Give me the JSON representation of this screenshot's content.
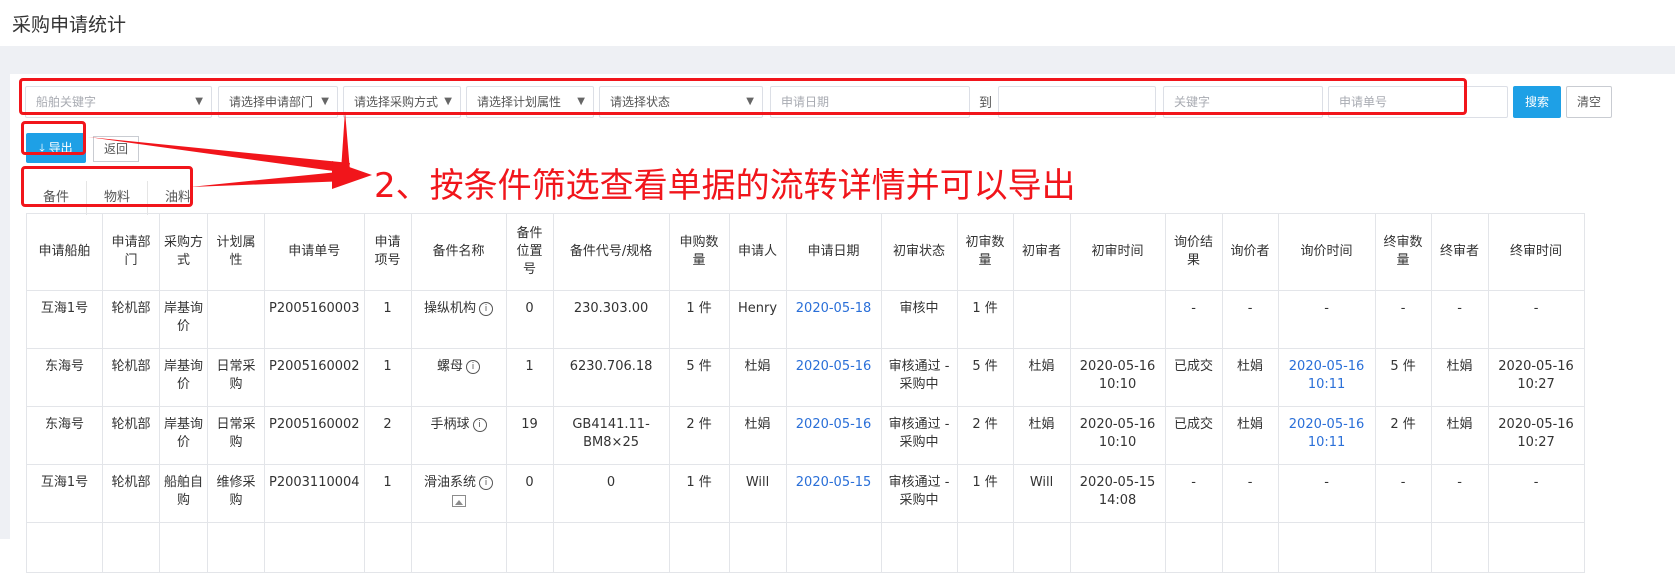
{
  "page": {
    "title": "采购申请统计"
  },
  "filters": {
    "ship": "船舶关键字",
    "dept": "请选择申请部门",
    "method": "请选择采购方式",
    "plan": "请选择计划属性",
    "status": "请选择状态",
    "date_start": "申请日期",
    "to": "到",
    "keyword": "关键字",
    "order_no": "申请单号",
    "search": "搜索",
    "clear": "清空"
  },
  "toolbar": {
    "export": "导出",
    "back": "返回"
  },
  "tabs": [
    "备件",
    "物料",
    "油料"
  ],
  "annotation": "2、按条件筛选查看单据的流转详情并可以导出",
  "table": {
    "columns": [
      "申请船舶",
      "申请部门",
      "采购方式",
      "计划属性",
      "申请单号",
      "申请项号",
      "备件名称",
      "备件位置号",
      "备件代号/规格",
      "申购数量",
      "申请人",
      "申请日期",
      "初审状态",
      "初审数量",
      "初审者",
      "初审时间",
      "询价结果",
      "询价者",
      "询价时间",
      "终审数量",
      "终审者",
      "终审时间"
    ],
    "rows": [
      [
        "互海1号",
        "轮机部",
        "岸基询价",
        "",
        "P2005160003",
        "1",
        "操纵机构",
        "0",
        "230.303.00",
        "1 件",
        "Henry",
        "2020-05-18",
        "审核中",
        "1 件",
        "",
        "",
        "-",
        "-",
        "-",
        "-",
        "-",
        "-"
      ],
      [
        "东海号",
        "轮机部",
        "岸基询价",
        "日常采购",
        "P2005160002",
        "1",
        "螺母",
        "1",
        "6230.706.18",
        "5 件",
        "杜娟",
        "2020-05-16",
        "审核通过 - 采购中",
        "5 件",
        "杜娟",
        "2020-05-16 10:10",
        "已成交",
        "杜娟",
        "2020-05-16 10:11",
        "5 件",
        "杜娟",
        "2020-05-16 10:27"
      ],
      [
        "东海号",
        "轮机部",
        "岸基询价",
        "日常采购",
        "P2005160002",
        "2",
        "手柄球",
        "19",
        "GB4141.11-BM8×25",
        "2 件",
        "杜娟",
        "2020-05-16",
        "审核通过 - 采购中",
        "2 件",
        "杜娟",
        "2020-05-16 10:10",
        "已成交",
        "杜娟",
        "2020-05-16 10:11",
        "2 件",
        "杜娟",
        "2020-05-16 10:27"
      ],
      [
        "互海1号",
        "轮机部",
        "船舶自购",
        "维修采购",
        "P2003110004",
        "1",
        "滑油系统",
        "0",
        "0",
        "1 件",
        "Will",
        "2020-05-15",
        "审核通过 - 采购中",
        "1 件",
        "Will",
        "2020-05-15 14:08",
        "-",
        "-",
        "-",
        "-",
        "-",
        "-"
      ]
    ]
  },
  "colors": {
    "accent": "#1ea0e6",
    "annotation": "#f1151b",
    "link": "#2a6fd8"
  },
  "icons": {
    "export": "download-icon",
    "info": "info-icon",
    "image": "image-icon",
    "dropdown": "caret-down-icon"
  }
}
